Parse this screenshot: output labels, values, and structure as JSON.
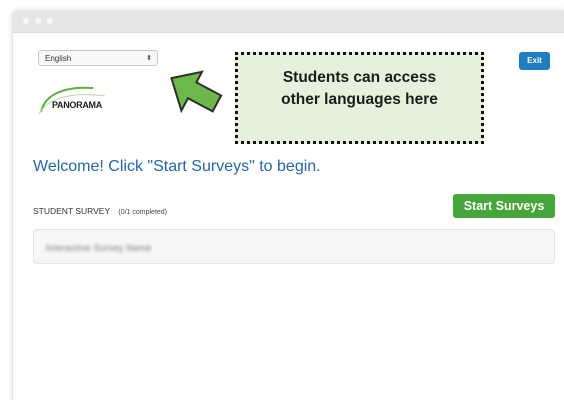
{
  "language_select": {
    "value": "English",
    "caret": "⬍"
  },
  "logo": {
    "text": "PANORAMA"
  },
  "callout": {
    "line1": "Students can access",
    "line2": "other languages here"
  },
  "exit_button": {
    "label": "Exit"
  },
  "welcome": {
    "text": "Welcome! Click \"Start Surveys\" to begin."
  },
  "survey_section": {
    "label": "STUDENT SURVEY",
    "progress": "(0/1 completed)",
    "start_button": "Start Surveys",
    "item_name": "Interactive Survey Name"
  },
  "colors": {
    "accent_blue": "#2167b3",
    "exit_blue": "#1f7ec2",
    "start_green": "#46a63a",
    "callout_bg": "#e5f1dc",
    "arrow_green": "#6db84a"
  }
}
